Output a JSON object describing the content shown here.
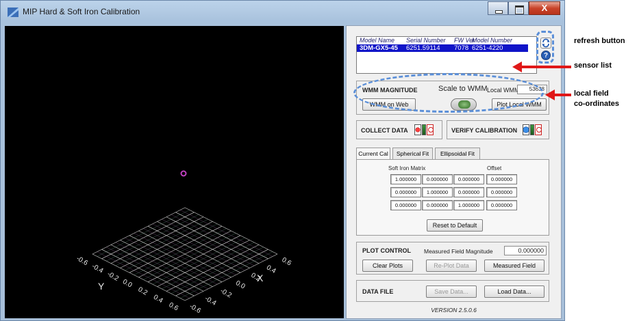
{
  "window": {
    "title": "MIP Hard & Soft Iron Calibration",
    "close_glyph": "X"
  },
  "view3d": {
    "axis_y": "Y",
    "axis_x": "X",
    "left_ticks": [
      "-0.6",
      "-0.4",
      "-0.2",
      "0.0",
      "0.2",
      "0.4",
      "0.6"
    ],
    "right_ticks": [
      "0.6",
      "0.4",
      "0.2",
      "0.0",
      "-0.2",
      "-0.4",
      "-0.6"
    ],
    "colors": {
      "grid": "#d8d8d8",
      "point": "#c040c0"
    }
  },
  "sensor_list": {
    "headers": [
      "Model Name",
      "Serial Number",
      "FW Ver",
      "Model Number"
    ],
    "rows": [
      {
        "model_name": "3DM-GX5-45",
        "serial": "6251.59114",
        "fw": "7078",
        "model_number": "6251-4220"
      }
    ]
  },
  "help_glyph": "?",
  "wmm": {
    "title": "WMM MAGNITUDE",
    "scale_label": "Scale to WMM",
    "local_label": "Local WMM:",
    "local_value": "53638",
    "web_button": "WMM on Web",
    "plot_button": "Plot Local WMM"
  },
  "collect": {
    "label": "COLLECT DATA"
  },
  "verify": {
    "label": "VERIFY CALIBRATION"
  },
  "tabs": [
    "Current Cal",
    "Spherical Fit",
    "Ellipsoidal Fit"
  ],
  "current_cal": {
    "matrix_label": "Soft Iron Matrix",
    "offset_label": "Offset",
    "matrix": [
      [
        "1.000000",
        "0.000000",
        "0.000000"
      ],
      [
        "0.000000",
        "1.000000",
        "0.000000"
      ],
      [
        "0.000000",
        "0.000000",
        "1.000000"
      ]
    ],
    "offset": [
      "0.000000",
      "0.000000",
      "0.000000"
    ],
    "reset_button": "Reset to Default"
  },
  "plot_control": {
    "title": "PLOT CONTROL",
    "measured_label": "Measured Field Magnitude",
    "measured_value": "0.000000",
    "clear_button": "Clear Plots",
    "replot_button": "Re-Plot Data",
    "measured_button": "Measured Field"
  },
  "data_file": {
    "title": "DATA FILE",
    "save_button": "Save Data...",
    "load_button": "Load Data..."
  },
  "version": "VERSION  2.5.0.6",
  "annotations": {
    "refresh": "refresh button",
    "sensor_list": "sensor  list",
    "local_field_1": "local field",
    "local_field_2": "co-ordinates",
    "colors": {
      "arrow": "#e01818",
      "dash": "#5b8fd8"
    }
  }
}
